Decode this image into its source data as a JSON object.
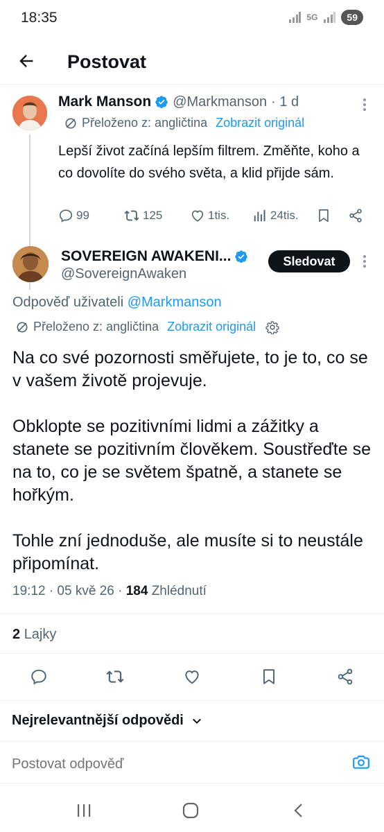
{
  "status_bar": {
    "time": "18:35",
    "network": "5G",
    "battery": "59"
  },
  "header": {
    "title": "Postovat",
    "back_icon": "arrow-left-icon"
  },
  "parent_tweet": {
    "author_name": "Mark Manson",
    "handle": "@Markmanson",
    "time": "· 1 d",
    "translated_label": "Přeloženo z: angličtina",
    "show_original": "Zobrazit originál",
    "text": "Lepší život začíná lepším filtrem. Změňte, koho a co dovolíte do svého světa, a klid přijde sám.",
    "replies": "99",
    "reposts": "125",
    "likes": "1tis.",
    "views": "24tis."
  },
  "reply_tweet": {
    "author_name": "SOVEREIGN AWAKENI...",
    "handle": "@SovereignAwaken",
    "follow_label": "Sledovat",
    "replying_to_prefix": "Odpověď uživateli",
    "replying_to": "@Markmanson",
    "translated_label": "Přeloženo z: angličtina",
    "show_original": "Zobrazit originál",
    "paragraphs": [
      "Na co své pozornosti směřujete, to je to, co se v vašem životě projevuje.",
      "Obklopte se pozitivními lidmi a zážitky a stanete se pozitivním člověkem. Soustřeďte se na to, co je se světem špatně, a stanete se hořkým.",
      "Tohle zní jednoduše, ale musíte si to neustále připomínat."
    ],
    "timestamp": "19:12 · 05 kvě 26 ·",
    "views_count": "184",
    "views_label": "Zhlédnutí",
    "likes_count": "2",
    "likes_label": "Lajky"
  },
  "sort_label": "Nejrelevantnější odpovědi",
  "compose": {
    "placeholder": "Postovat odpověď"
  },
  "colors": {
    "accent": "#1d9bf0",
    "text": "#0f1419",
    "muted": "#536471",
    "button": "#0f1419"
  }
}
